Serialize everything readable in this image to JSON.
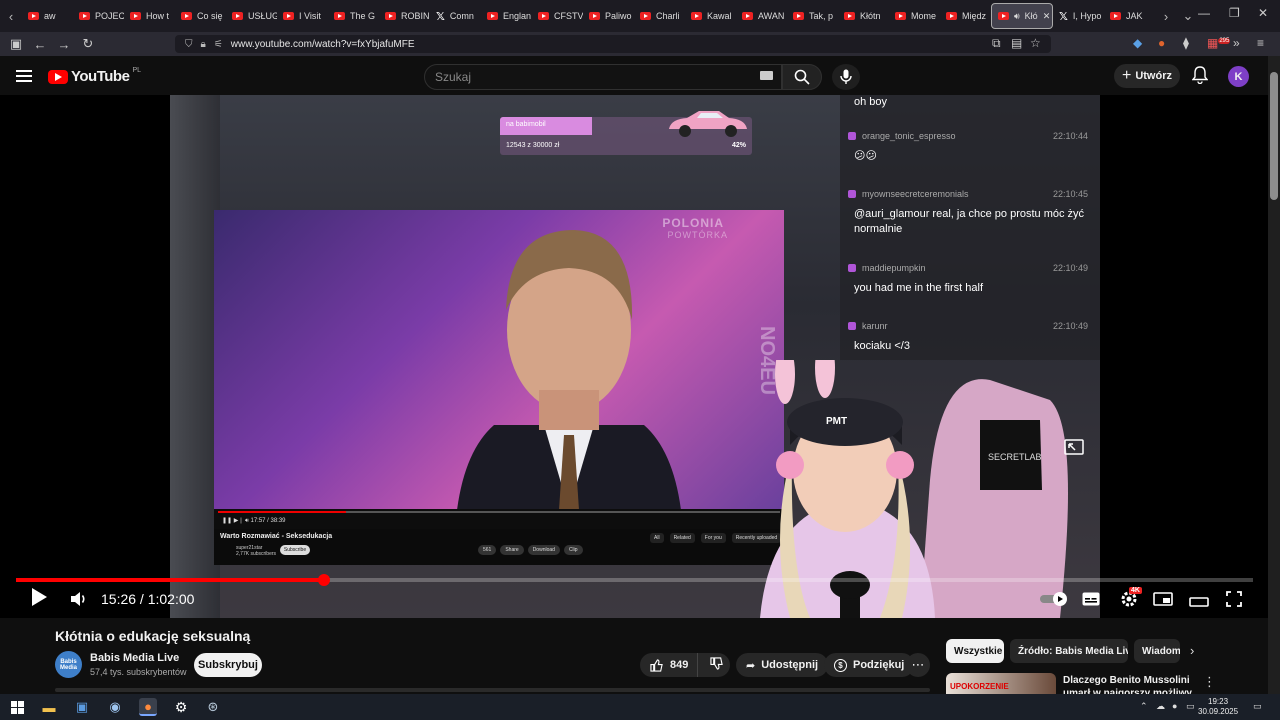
{
  "browser": {
    "tabs": [
      {
        "label": "aw",
        "icon": "youtube-icon"
      },
      {
        "label": "POJEC",
        "icon": "youtube-icon"
      },
      {
        "label": "How t",
        "icon": "youtube-icon"
      },
      {
        "label": "Co się",
        "icon": "youtube-icon"
      },
      {
        "label": "USŁUG",
        "icon": "youtube-icon"
      },
      {
        "label": "I Visit",
        "icon": "youtube-icon"
      },
      {
        "label": "The G",
        "icon": "youtube-icon"
      },
      {
        "label": "ROBIN",
        "icon": "youtube-icon"
      },
      {
        "label": "Comn",
        "icon": "x-icon"
      },
      {
        "label": "Englan",
        "icon": "youtube-icon"
      },
      {
        "label": "CFSTV",
        "icon": "youtube-icon"
      },
      {
        "label": "Paliwo",
        "icon": "youtube-icon"
      },
      {
        "label": "Charli",
        "icon": "youtube-icon"
      },
      {
        "label": "Kawal",
        "icon": "youtube-icon"
      },
      {
        "label": "AWAN",
        "icon": "youtube-icon"
      },
      {
        "label": "Tak, p",
        "icon": "youtube-icon"
      },
      {
        "label": "Kłótn",
        "icon": "youtube-icon"
      },
      {
        "label": "Mome",
        "icon": "youtube-icon"
      },
      {
        "label": "Międz",
        "icon": "youtube-icon"
      },
      {
        "label": "Kłó",
        "icon": "youtube-icon",
        "active": true
      },
      {
        "label": "I, Hypo",
        "icon": "x-icon"
      },
      {
        "label": "JAK",
        "icon": "youtube-icon"
      }
    ],
    "url": "www.youtube.com/watch?v=fxYbjafuMFE",
    "notification_count": "295"
  },
  "youtube": {
    "logo_text": "YouTube",
    "region": "PL",
    "search_placeholder": "Szukaj",
    "create_label": "Utwórz",
    "avatar_letter": "K"
  },
  "stream": {
    "goal": {
      "label": "na babimobil",
      "progress_text": "12543 z 30000 zł",
      "percent_text": "42%",
      "fill_fraction": 0.42
    },
    "inner_video": {
      "brand": "POLONIA",
      "brand_sub": "POWTÓRKA",
      "side_text": "NO4EU",
      "time": "17:57 / 38:39",
      "title": "Warto Rozmawiać - Seksedukacja",
      "channel": "super21star",
      "channel_subs": "2,77K subscribers",
      "subscribe": "Subscribe",
      "actions": [
        "561",
        "Share",
        "Download",
        "Clip"
      ],
      "tabs": [
        "All",
        "Related",
        "For you",
        "Recently uploaded"
      ]
    },
    "chat": [
      {
        "user": "",
        "time": "",
        "text": "oh boy"
      },
      {
        "user": "orange_tonic_espresso",
        "time": "22:10:44",
        "text": "😕😕"
      },
      {
        "user": "myownseecretceremonials",
        "time": "22:10:45",
        "text": "@auri_glamour real, ja chce po prostu móc żyć normalnie"
      },
      {
        "user": "maddiepumpkin",
        "time": "22:10:49",
        "text": "you had me in the first half"
      },
      {
        "user": "karunr",
        "time": "22:10:49",
        "text": "kociaku </3"
      }
    ],
    "chair_text": "SECRETLAB",
    "cap_text": "PMT"
  },
  "player": {
    "current_time": "15:26",
    "duration": "1:02:00",
    "time_display": "15:26 / 1:02:00",
    "progress_fraction": 0.249,
    "quality_badge": "4K"
  },
  "video": {
    "title": "Kłótnia o edukację seksualną",
    "channel_name": "Babis Media Live",
    "channel_avatar_text": "Babis Media",
    "subscribers": "57,4 tys. subskrybentów",
    "subscribe_label": "Subskrybuj",
    "likes": "849",
    "share_label": "Udostępnij",
    "thanks_label": "Podziękuj"
  },
  "related": {
    "chips": [
      "Wszystkie",
      "Źródło: Babis Media Live",
      "Wiadomo"
    ],
    "first_title": "Dlaczego Benito Mussolini umarł w najgorszy możliwy",
    "first_thumb_text": "UPOKORZENIE"
  },
  "taskbar": {
    "time": "19:23",
    "date": "30.09.2025"
  }
}
